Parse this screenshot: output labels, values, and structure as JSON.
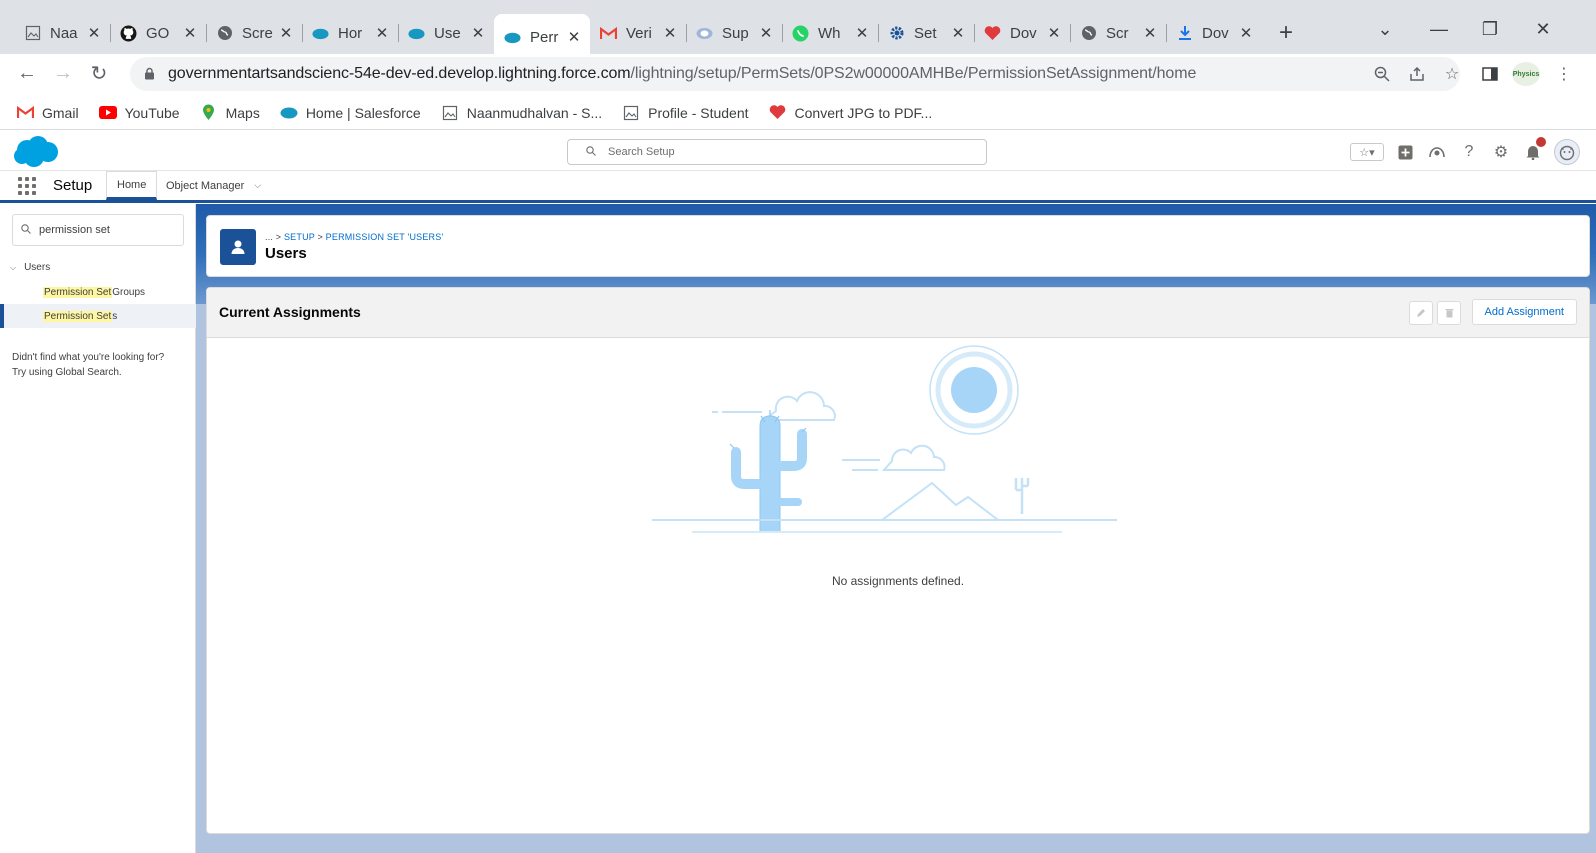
{
  "browser": {
    "tabs": [
      {
        "title": "Naa",
        "icon": "image-file-icon"
      },
      {
        "title": "GO",
        "icon": "github-icon"
      },
      {
        "title": "Scre",
        "icon": "globe-icon"
      },
      {
        "title": "Hor",
        "icon": "salesforce-cloud-icon"
      },
      {
        "title": "Use",
        "icon": "salesforce-cloud-icon"
      },
      {
        "title": "Perr",
        "icon": "salesforce-cloud-icon"
      },
      {
        "title": "Veri",
        "icon": "gmail-icon"
      },
      {
        "title": "Sup",
        "icon": "support-icon"
      },
      {
        "title": "Wh",
        "icon": "whatsapp-icon"
      },
      {
        "title": "Set",
        "icon": "gear-icon"
      },
      {
        "title": "Dov",
        "icon": "heart-icon"
      },
      {
        "title": "Scr",
        "icon": "globe-icon"
      },
      {
        "title": "Dov",
        "icon": "download-icon"
      }
    ],
    "url_host": "governmentartsandscienc-54e-dev-ed.develop.lightning.force.com",
    "url_path": "/lightning/setup/PermSets/0PS2w00000AMHBe/PermissionSetAssignment/home",
    "profile_label": "Physics",
    "bookmarks": [
      {
        "label": "Gmail",
        "icon": "gmail-icon"
      },
      {
        "label": "YouTube",
        "icon": "youtube-icon"
      },
      {
        "label": "Maps",
        "icon": "maps-pin-icon"
      },
      {
        "label": "Home | Salesforce",
        "icon": "salesforce-cloud-icon"
      },
      {
        "label": "Naanmudhalvan - S...",
        "icon": "image-file-icon"
      },
      {
        "label": "Profile - Student",
        "icon": "image-file-icon"
      },
      {
        "label": "Convert JPG to PDF...",
        "icon": "heart-icon"
      }
    ]
  },
  "sf_header": {
    "search_placeholder": "Search Setup"
  },
  "sf_nav": {
    "app_name": "Setup",
    "tabs": [
      {
        "label": "Home"
      },
      {
        "label": "Object Manager"
      }
    ]
  },
  "sidebar": {
    "quickfind_value": "permission set",
    "parent": "Users",
    "items": [
      {
        "prefix": "",
        "highlight": "Permission Set",
        "suffix": " Groups"
      },
      {
        "prefix": "",
        "highlight": "Permission Set",
        "suffix": "s"
      }
    ],
    "not_found_line1": "Didn't find what you're looking for?",
    "not_found_line2": "Try using Global Search."
  },
  "page_header": {
    "breadcrumb_prefix": "... > ",
    "breadcrumb_setup": "Setup",
    "breadcrumb_sep": " > ",
    "breadcrumb_current": "Permission Set 'Users'",
    "title": "Users"
  },
  "main": {
    "card_title": "Current Assignments",
    "add_button": "Add Assignment",
    "empty_message": "No assignments defined."
  }
}
